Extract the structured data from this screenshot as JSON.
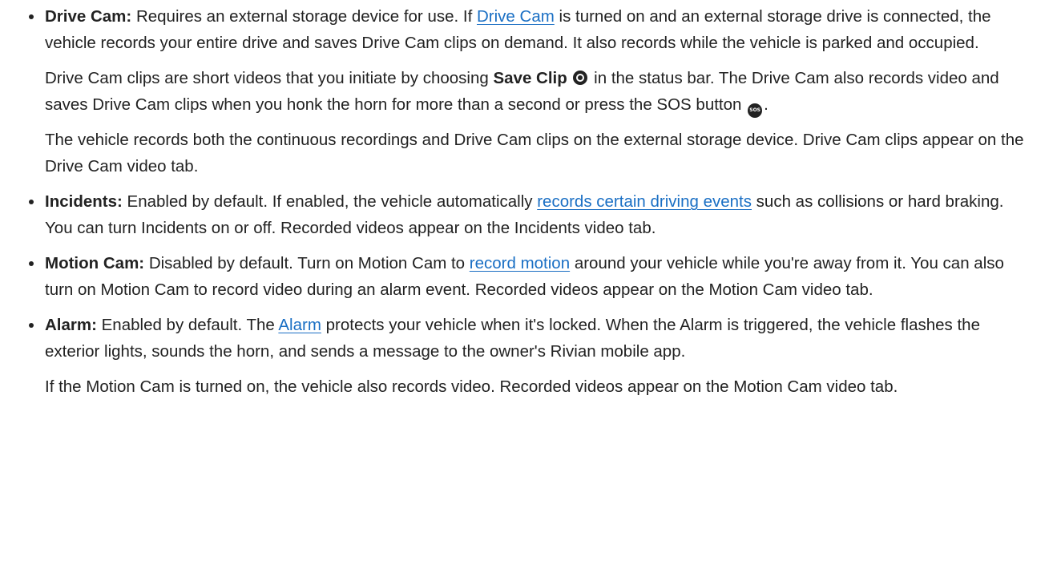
{
  "items": [
    {
      "term": "Drive Cam:",
      "p1_a": " Requires an external storage device for use. If ",
      "p1_link": "Drive Cam",
      "p1_b": " is turned on and an external storage drive is connected, the vehicle records your entire drive and saves Drive Cam clips on demand. It also records while the vehicle is parked and occupied.",
      "p2_a": "Drive Cam clips are short videos that you initiate by choosing ",
      "p2_bold": "Save Clip",
      "p2_b": " in the status bar. The Drive Cam also records video and saves Drive Cam clips when you honk the horn for more than a second or press the SOS button ",
      "p2_c": ".",
      "sos_glyph": "SOS",
      "p3": "The vehicle records both the continuous recordings and Drive Cam clips on the external storage device. Drive Cam clips appear on the Drive Cam video tab."
    },
    {
      "term": "Incidents:",
      "p1_a": " Enabled by default. If enabled, the vehicle automatically ",
      "p1_link": "records certain driving events",
      "p1_b": " such as collisions or hard braking. You can turn Incidents on or off. Recorded videos appear on the Incidents video tab."
    },
    {
      "term": "Motion Cam:",
      "p1_a": " Disabled by default. Turn on Motion Cam to ",
      "p1_link": "record motion",
      "p1_b": " around your vehicle while you're away from it. You can also turn on Motion Cam to record video during an alarm event. Recorded videos appear on the Motion Cam video tab."
    },
    {
      "term": "Alarm:",
      "p1_a": " Enabled by default. The ",
      "p1_link": "Alarm",
      "p1_b": " protects your vehicle when it's locked. When the Alarm is triggered, the vehicle flashes the exterior lights, sounds the horn, and sends a message to the owner's Rivian mobile app.",
      "p2": "If the Motion Cam is turned on, the vehicle also records video. Recorded videos appear on the Motion Cam video tab."
    }
  ],
  "icons": {
    "save_clip": "save-clip-icon",
    "sos": "sos-icon"
  },
  "colors": {
    "text": "#222222",
    "link": "#1a6fc4",
    "background": "#ffffff"
  }
}
